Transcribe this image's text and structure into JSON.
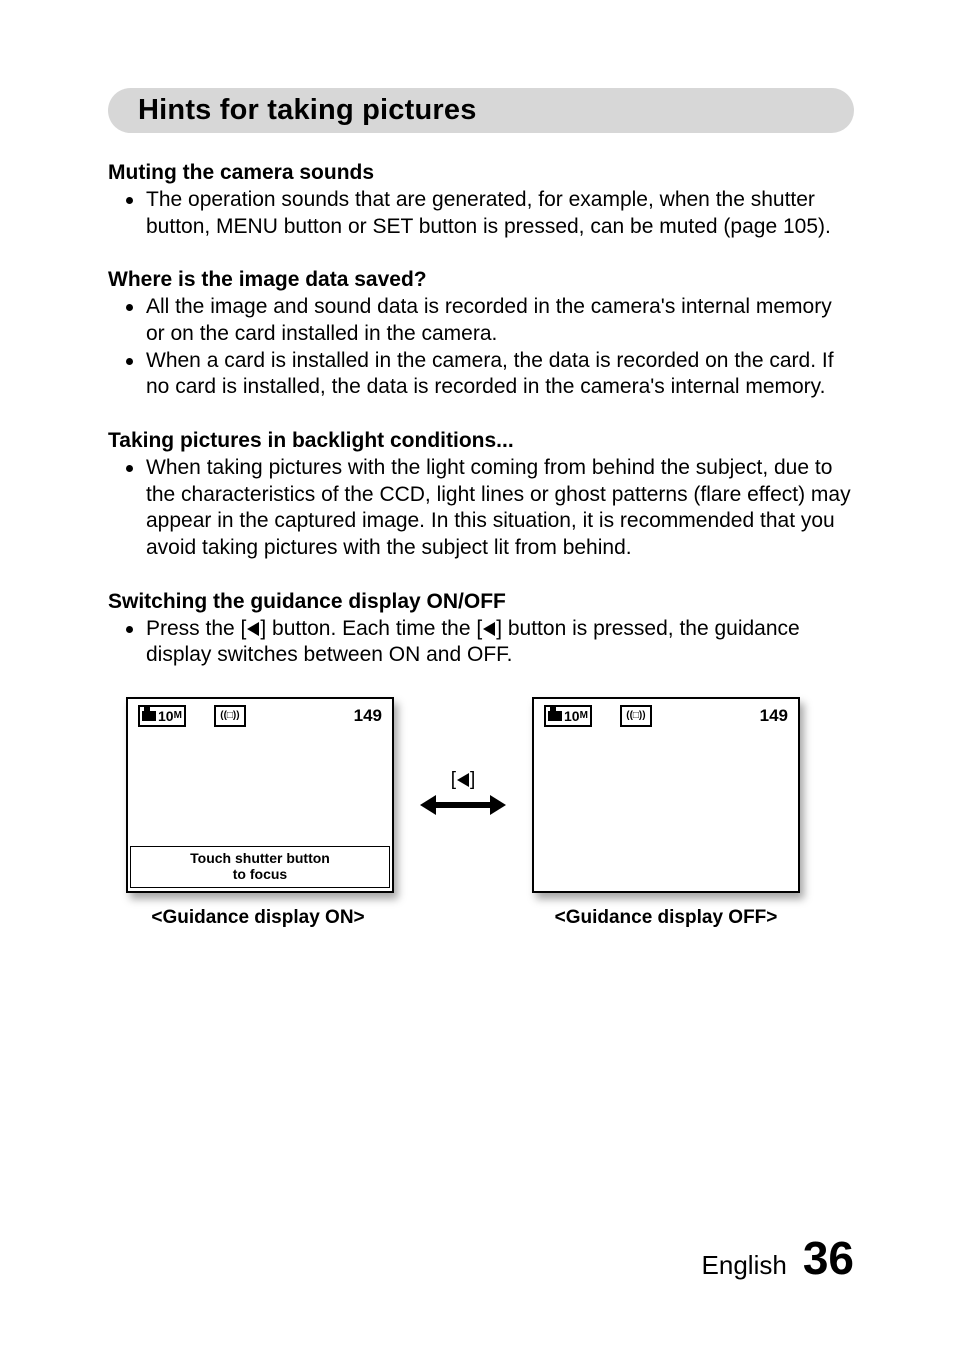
{
  "hint_title": "Hints for taking pictures",
  "sections": {
    "mute": {
      "head": "Muting the camera sounds",
      "bullets": [
        "The operation sounds that are generated, for example, when the shutter button, MENU button or SET button is pressed, can be muted (page 105)."
      ]
    },
    "where": {
      "head": "Where is the image data saved?",
      "bullets": [
        "All the image and sound data is recorded in the camera's internal memory or on the card installed in the camera.",
        "When a card is installed in the camera, the data is recorded on the card. If no card is installed, the data is recorded in the camera's internal memory."
      ]
    },
    "backlight": {
      "head": "Taking pictures in backlight conditions...",
      "bullets": [
        "When taking pictures with the light coming from behind the subject, due to the characteristics of the CCD, light lines or ghost patterns (flare effect) may appear in the captured image. In this situation, it is recommended that you avoid taking pictures with the subject lit from behind."
      ]
    },
    "guidance": {
      "head": "Switching the guidance display ON/OFF",
      "bullet_prefix": "Press the [",
      "bullet_mid": "] button. Each time the [",
      "bullet_suffix": "] button is pressed, the guidance display switches between ON and OFF."
    }
  },
  "camera": {
    "mode_text_ten": "10",
    "mode_text_m": "M",
    "stab_text": "((□))",
    "count": "149",
    "guide_line1": "Touch shutter button",
    "guide_line2": "to focus"
  },
  "captions": {
    "on": "<Guidance display ON>",
    "off": "<Guidance display OFF>"
  },
  "footer": {
    "lang": "English",
    "page": "36"
  }
}
